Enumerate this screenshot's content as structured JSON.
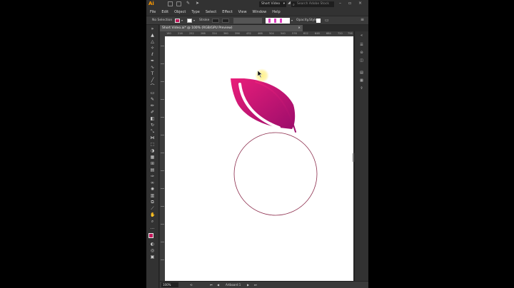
{
  "app": {
    "logo": "Ai",
    "workspace": "Short Video",
    "search_placeholder": "Search Adobe Stock"
  },
  "menubar": [
    "File",
    "Edit",
    "Object",
    "Type",
    "Select",
    "Effect",
    "View",
    "Window",
    "Help"
  ],
  "controlbar": {
    "selection_label": "No Selection",
    "stroke_label": "Stroke",
    "opacity_label": "Opacity",
    "style_label": "Style"
  },
  "document": {
    "tab_title": "Short Video.ai* @ 100% (RGB/GPU Preview)",
    "close": "×"
  },
  "ruler": {
    "ticks": [
      "180",
      "216",
      "252",
      "288",
      "324",
      "360",
      "396",
      "432",
      "468",
      "504",
      "540",
      "576",
      "612",
      "648",
      "684",
      "720",
      "756"
    ]
  },
  "statusbar": {
    "zoom": "100%",
    "artboard": "Artboard 1"
  },
  "artwork": {
    "gradient_start": "#9c0d6b",
    "gradient_end": "#e91e7a",
    "circle_stroke": "#8b2a4a"
  },
  "colors": {
    "fill": "#c2185b",
    "accent": "#ff9a00"
  }
}
